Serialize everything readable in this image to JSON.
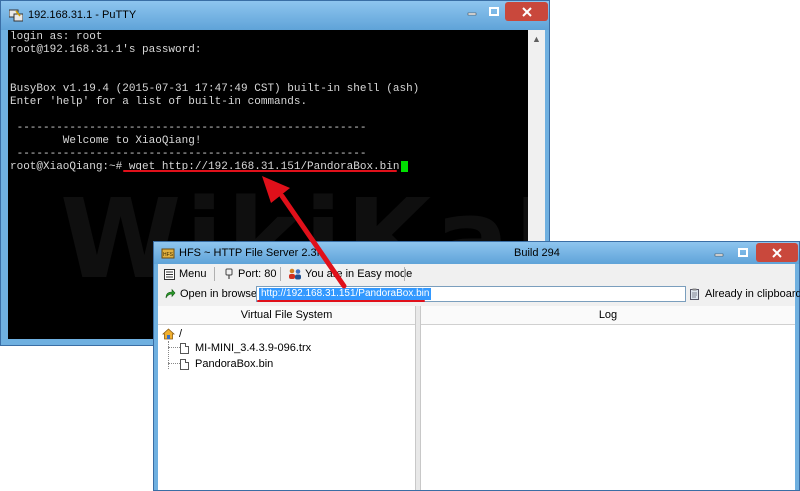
{
  "putty": {
    "title": "192.168.31.1 - PuTTY",
    "lines": [
      "login as: root",
      "root@192.168.31.1's password:",
      "",
      "",
      "BusyBox v1.19.4 (2015-07-31 17:47:49 CST) built-in shell (ash)",
      "Enter 'help' for a list of built-in commands.",
      "",
      " -----------------------------------------------------",
      "        Welcome to XiaoQiang!",
      " -----------------------------------------------------",
      "root@XiaoQiang:~# wget http://192.168.31.151/PandoraBox.bin"
    ]
  },
  "hfs": {
    "title": "HFS ~ HTTP File Server 2.3f",
    "build": "Build 294",
    "toolbar": {
      "menu_label": "Menu",
      "port_label": "Port: 80",
      "mode_label": "You are in Easy mode",
      "open_browser_label": "Open in browser",
      "url": "http://192.168.31.151/PandoraBox.bin",
      "clipboard_label": "Already in clipboard"
    },
    "vfs_header": "Virtual File System",
    "log_header": "Log",
    "tree": {
      "root": "/",
      "files": [
        "MI-MINI_3.4.3.9-096.trx",
        "PandoraBox.bin"
      ]
    }
  }
}
